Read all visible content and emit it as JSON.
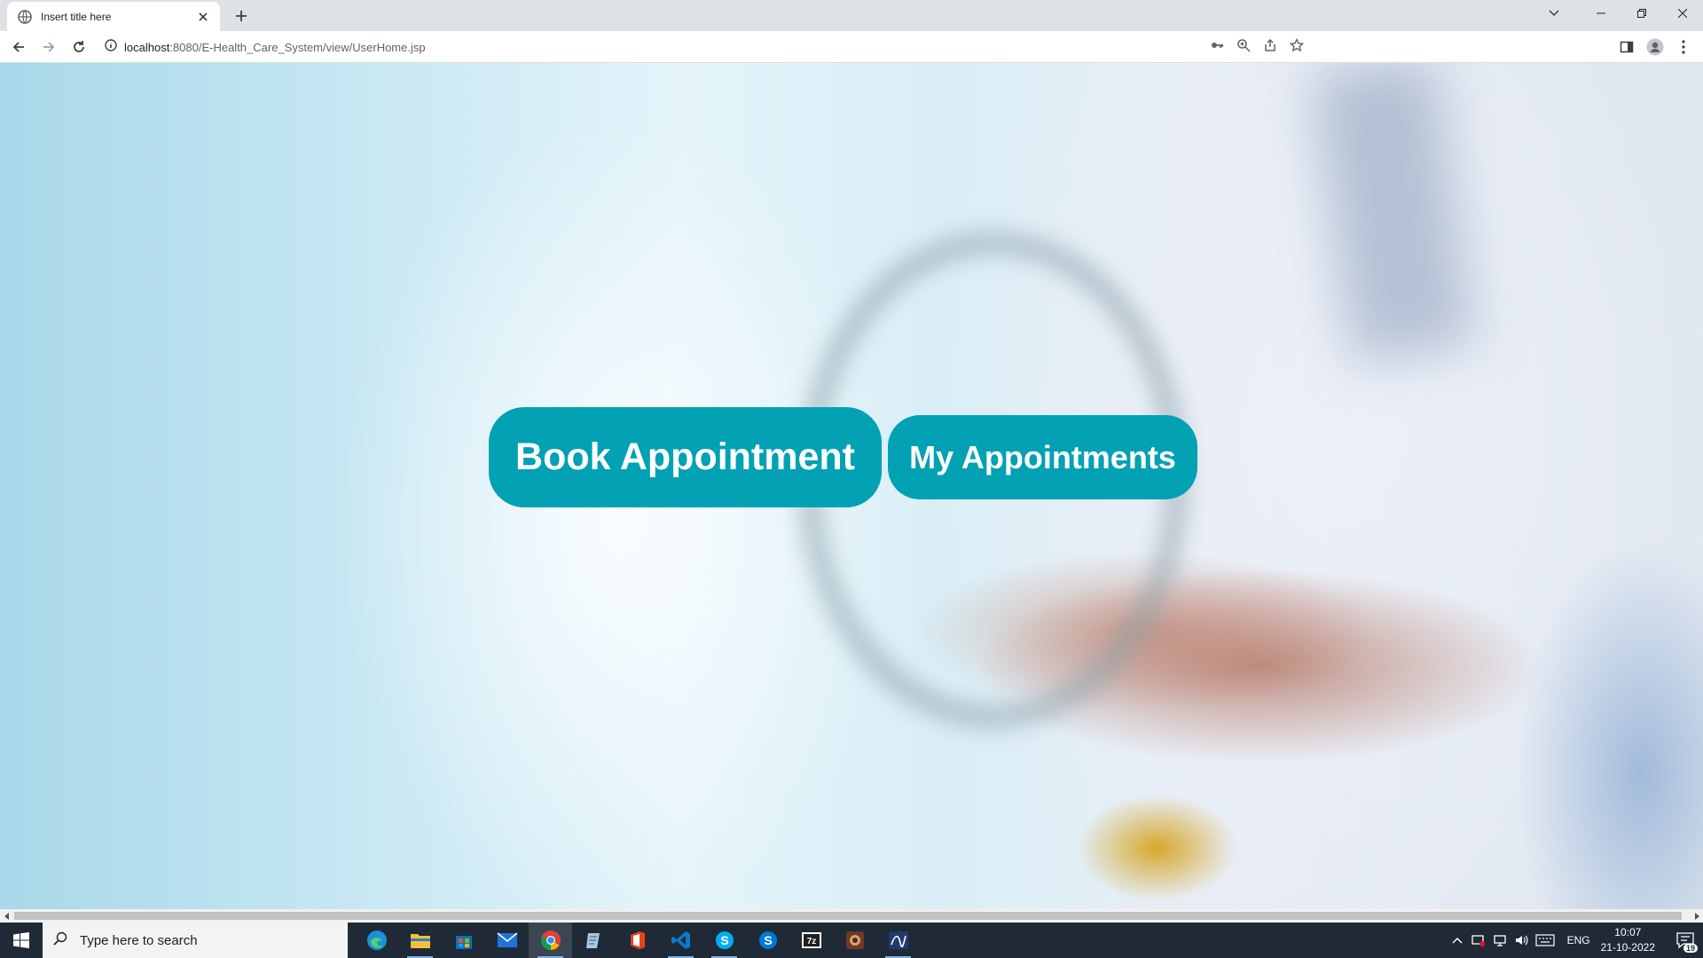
{
  "browser": {
    "tab_title": "Insert title here",
    "url_host": "localhost",
    "url_path": ":8080/E-Health_Care_System/view/UserHome.jsp"
  },
  "page": {
    "book_appointment_label": "Book Appointment",
    "my_appointments_label": "My Appointments",
    "button_color": "#02a1b3"
  },
  "taskbar": {
    "search_placeholder": "Type here to search",
    "apps": [
      "edge-icon",
      "file-explorer-icon",
      "store-icon",
      "mail-icon",
      "chrome-icon",
      "notepad-icon",
      "office-icon",
      "vscode-icon",
      "skype-icon",
      "skype-icon",
      "7zip-icon",
      "app-icon",
      "sql-icon"
    ],
    "language": "ENG",
    "time": "10:07",
    "date": "21-10-2022",
    "notification_count": "19"
  }
}
